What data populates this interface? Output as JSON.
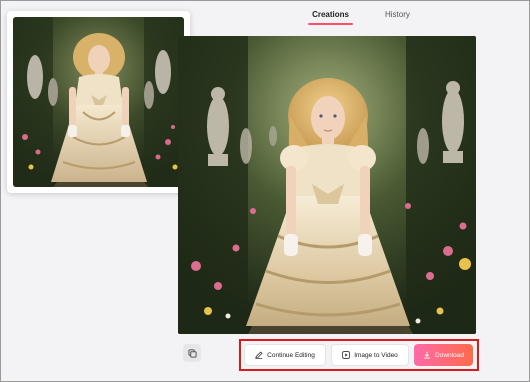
{
  "tabs": [
    {
      "label": "Creations",
      "active": true
    },
    {
      "label": "History",
      "active": false
    }
  ],
  "thumbnail": {
    "alt": "Generated image thumbnail: young girl in cream gown in a garden"
  },
  "preview": {
    "alt": "Generated image preview: young girl with curly blonde hair in a satin ball gown standing in a garden path with statues"
  },
  "actions": {
    "continue_editing": "Continue Editing",
    "image_to_video": "Image to Video",
    "download": "Download"
  },
  "icons": {
    "continue_editing": "pencil-icon",
    "image_to_video": "video-play-icon",
    "download": "download-icon",
    "side": "copy-icon"
  },
  "colors": {
    "accent": "#ff4d6d",
    "download_start": "#ff6aa8",
    "download_end": "#ff6a4a",
    "highlight_border": "#d81b1b"
  }
}
